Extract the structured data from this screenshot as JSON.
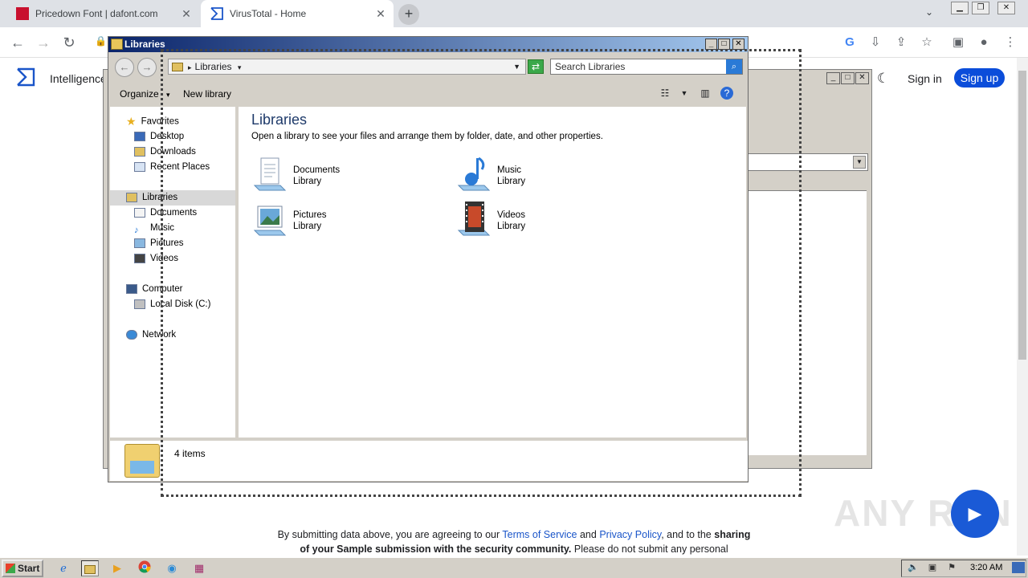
{
  "browser": {
    "tabs": [
      {
        "title": "Pricedown Font | dafont.com",
        "active": false
      },
      {
        "title": "VirusTotal - Home",
        "active": true
      }
    ],
    "new_tab": "+"
  },
  "page": {
    "intelligence": "Intelligence",
    "sign_in": "Sign in",
    "sign_up": "Sign up",
    "footer": {
      "line1_pre": "By submitting data above, you are agreeing to our",
      "terms": "Terms of Service",
      "and": "and",
      "privacy": "Privacy Policy",
      "line1_post": ", and to the",
      "sharing": "sharing",
      "line2_bold": "of your Sample submission with the security community.",
      "line2_rest": "Please do not submit any personal"
    }
  },
  "explorer": {
    "title": "Libraries",
    "address": "Libraries",
    "search_placeholder": "Search Libraries",
    "organize": "Organize",
    "new_library": "New library",
    "heading": "Libraries",
    "subtitle": "Open a library to see your files and arrange them by folder, date, and other properties.",
    "nav": {
      "favorites": "Favorites",
      "desktop": "Desktop",
      "downloads": "Downloads",
      "recent": "Recent Places",
      "libraries": "Libraries",
      "documents": "Documents",
      "music": "Music",
      "pictures": "Pictures",
      "videos": "Videos",
      "computer": "Computer",
      "local_disk": "Local Disk (C:)",
      "network": "Network"
    },
    "libs": [
      {
        "name": "Documents",
        "type": "Library"
      },
      {
        "name": "Music",
        "type": "Library"
      },
      {
        "name": "Pictures",
        "type": "Library"
      },
      {
        "name": "Videos",
        "type": "Library"
      }
    ],
    "status": "4 items"
  },
  "taskbar": {
    "start": "Start",
    "clock": "3:20 AM"
  },
  "watermark": "ANY RUN"
}
